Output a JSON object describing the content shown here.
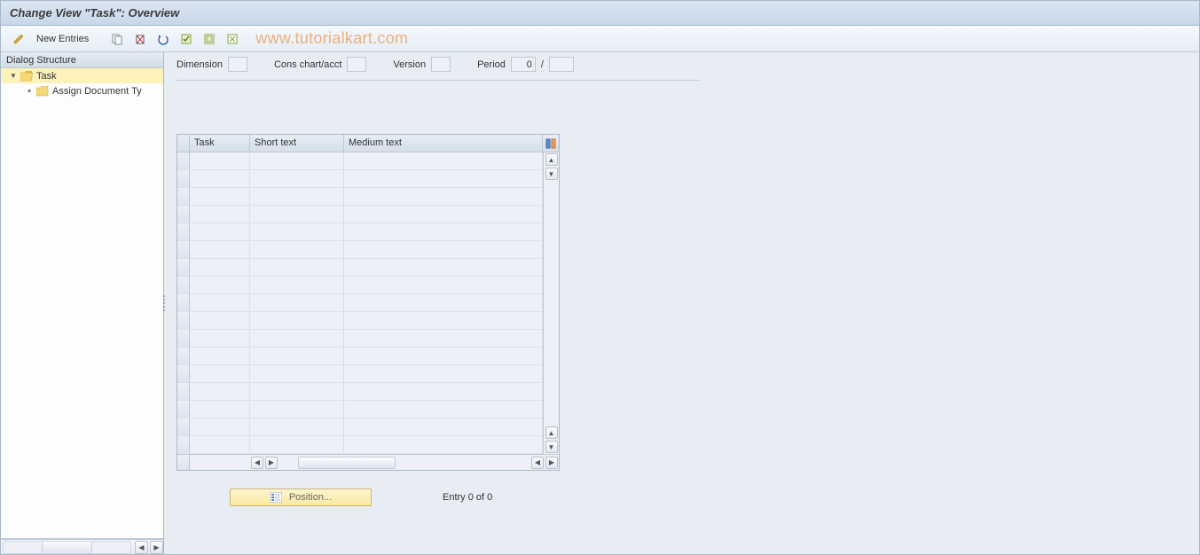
{
  "title": "Change View \"Task\": Overview",
  "watermark": "www.tutorialkart.com",
  "toolbar": {
    "new_entries": "New Entries"
  },
  "tree": {
    "header": "Dialog Structure",
    "items": [
      {
        "label": "Task",
        "level": 1,
        "selected": true,
        "open": true
      },
      {
        "label": "Assign Document Ty",
        "level": 2,
        "selected": false,
        "open": false
      }
    ]
  },
  "fields": {
    "dimension": {
      "label": "Dimension",
      "value": ""
    },
    "cons_chart": {
      "label": "Cons chart/acct",
      "value": ""
    },
    "version": {
      "label": "Version",
      "value": ""
    },
    "period": {
      "label": "Period",
      "value": "0"
    },
    "period_sep": "/",
    "period2": {
      "value": ""
    }
  },
  "table": {
    "columns": {
      "task": "Task",
      "short": "Short text",
      "medium": "Medium text"
    },
    "rows": [
      {},
      {},
      {},
      {},
      {},
      {},
      {},
      {},
      {},
      {},
      {},
      {},
      {},
      {},
      {},
      {},
      {}
    ]
  },
  "footer": {
    "position_btn": "Position...",
    "entry_text": "Entry 0 of 0"
  }
}
